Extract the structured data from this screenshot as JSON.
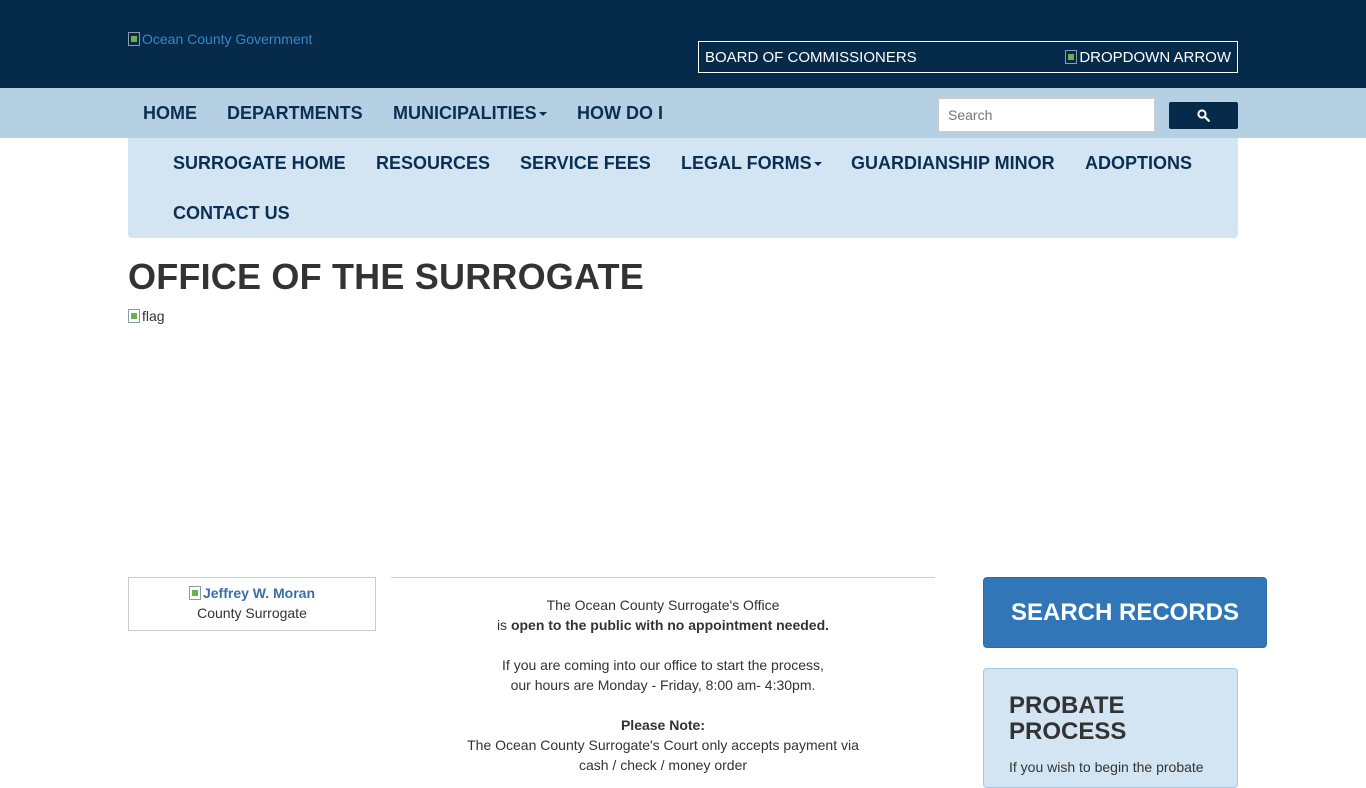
{
  "header": {
    "logo_alt": "Ocean County Government",
    "board_label": "BOARD OF COMMISSIONERS",
    "dropdown_alt": "DROPDOWN ARROW"
  },
  "main_nav": {
    "items": [
      {
        "label": "HOME"
      },
      {
        "label": "DEPARTMENTS"
      },
      {
        "label": "MUNICIPALITIES",
        "dropdown": true
      },
      {
        "label": "HOW DO I"
      }
    ],
    "search_placeholder": "Search",
    "search_icon": "search-icon"
  },
  "sub_nav": {
    "items": [
      {
        "label": "SURROGATE HOME"
      },
      {
        "label": "RESOURCES"
      },
      {
        "label": "SERVICE FEES"
      },
      {
        "label": "LEGAL FORMS",
        "dropdown": true
      },
      {
        "label": "GUARDIANSHIP MINOR"
      },
      {
        "label": "ADOPTIONS"
      },
      {
        "label": "CONTACT US"
      }
    ]
  },
  "page": {
    "title": "OFFICE OF THE SURROGATE",
    "flag_alt": "flag"
  },
  "profile": {
    "name": "Jeffrey W. Moran",
    "role": "County Surrogate"
  },
  "content": {
    "line1": "The Ocean County Surrogate's Office",
    "line2_prefix": "is ",
    "line2_bold": "open to the public with no appointment needed.",
    "line3": "If you are coming into our office to start the process,",
    "line4": "our hours are Monday - Friday, 8:00 am- 4:30pm.",
    "note_label": "Please Note:",
    "line5": "The Ocean County Surrogate's Court only accepts payment via",
    "line6": "cash / check / money order"
  },
  "sidebar": {
    "search_records_label": "SEARCH RECORDS",
    "probate_title": "PROBATE PROCESS",
    "probate_text": "If you wish to begin the probate"
  },
  "colors": {
    "topbar": "#062a49",
    "main_nav": "#b5d0e3",
    "sub_nav": "#d3e5f2",
    "nav_text": "#0b2f52",
    "button_blue": "#3177b8"
  }
}
